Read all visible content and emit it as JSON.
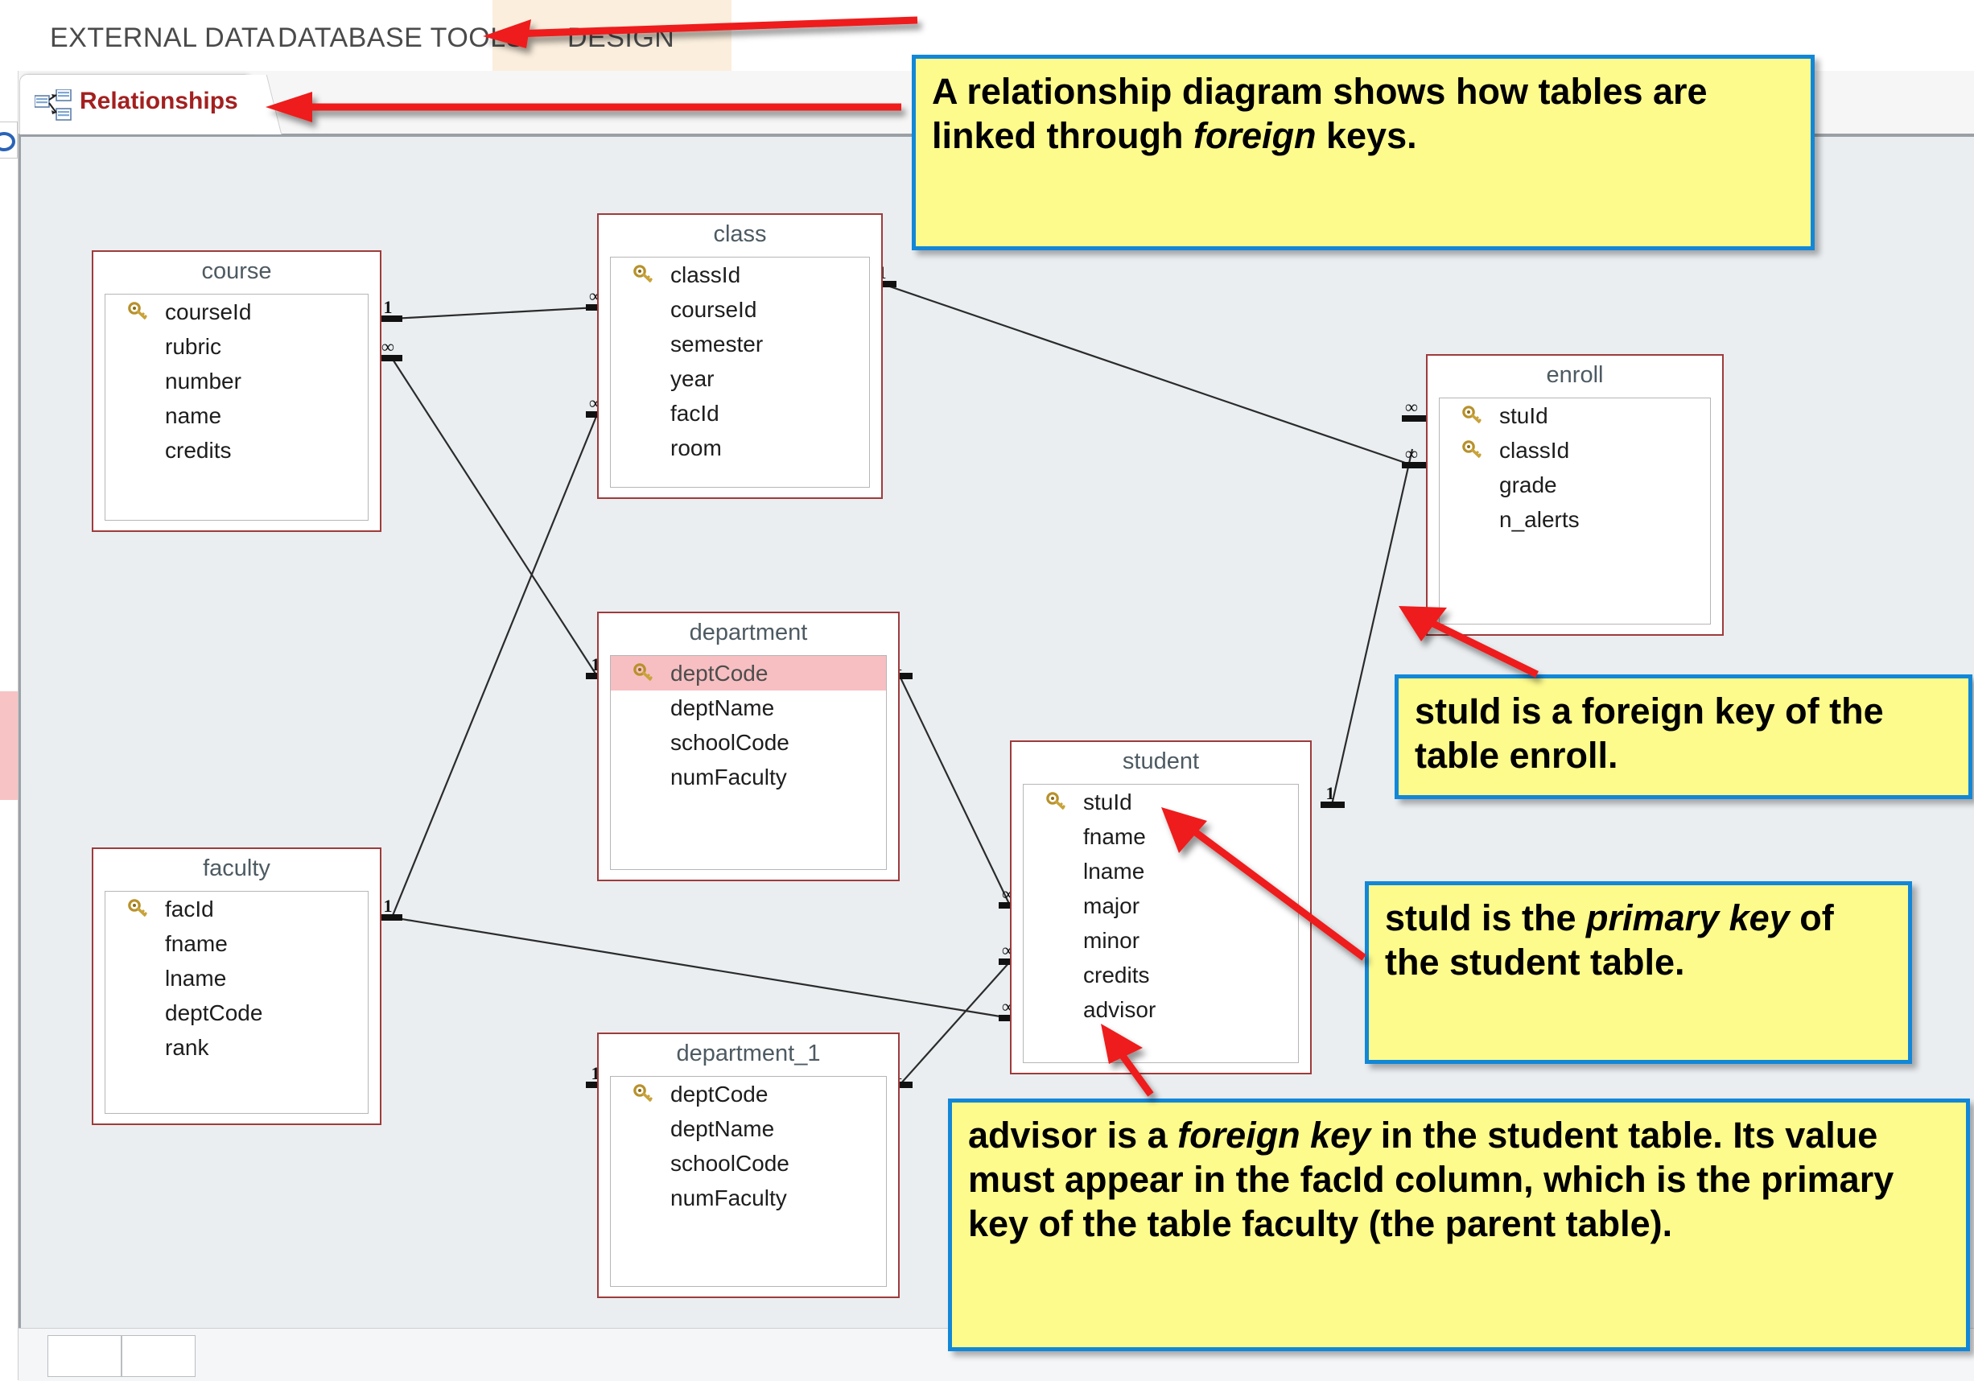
{
  "ribbon": {
    "tabs": [
      {
        "label": "EXTERNAL DATA"
      },
      {
        "label": "DATABASE TOOLS"
      },
      {
        "label": "DESIGN"
      }
    ]
  },
  "document_tab": {
    "label": "Relationships",
    "icon": "relationships-icon"
  },
  "diagram": {
    "type": "relationship-diagram",
    "tables": [
      {
        "name": "course",
        "fields": [
          {
            "label": "courseId",
            "primary_key": true,
            "selected": false
          },
          {
            "label": "rubric",
            "primary_key": false,
            "selected": false
          },
          {
            "label": "number",
            "primary_key": false,
            "selected": false
          },
          {
            "label": "name",
            "primary_key": false,
            "selected": false
          },
          {
            "label": "credits",
            "primary_key": false,
            "selected": false
          }
        ]
      },
      {
        "name": "class",
        "fields": [
          {
            "label": "classId",
            "primary_key": true,
            "selected": false
          },
          {
            "label": "courseId",
            "primary_key": false,
            "selected": false
          },
          {
            "label": "semester",
            "primary_key": false,
            "selected": false
          },
          {
            "label": "year",
            "primary_key": false,
            "selected": false
          },
          {
            "label": "facId",
            "primary_key": false,
            "selected": false
          },
          {
            "label": "room",
            "primary_key": false,
            "selected": false
          }
        ]
      },
      {
        "name": "enroll",
        "fields": [
          {
            "label": "stuId",
            "primary_key": true,
            "selected": false
          },
          {
            "label": "classId",
            "primary_key": true,
            "selected": false
          },
          {
            "label": "grade",
            "primary_key": false,
            "selected": false
          },
          {
            "label": "n_alerts",
            "primary_key": false,
            "selected": false
          }
        ]
      },
      {
        "name": "department",
        "fields": [
          {
            "label": "deptCode",
            "primary_key": true,
            "selected": true
          },
          {
            "label": "deptName",
            "primary_key": false,
            "selected": false
          },
          {
            "label": "schoolCode",
            "primary_key": false,
            "selected": false
          },
          {
            "label": "numFaculty",
            "primary_key": false,
            "selected": false
          }
        ]
      },
      {
        "name": "student",
        "fields": [
          {
            "label": "stuId",
            "primary_key": true,
            "selected": false
          },
          {
            "label": "fname",
            "primary_key": false,
            "selected": false
          },
          {
            "label": "lname",
            "primary_key": false,
            "selected": false
          },
          {
            "label": "major",
            "primary_key": false,
            "selected": false
          },
          {
            "label": "minor",
            "primary_key": false,
            "selected": false
          },
          {
            "label": "credits",
            "primary_key": false,
            "selected": false
          },
          {
            "label": "advisor",
            "primary_key": false,
            "selected": false
          }
        ]
      },
      {
        "name": "faculty",
        "fields": [
          {
            "label": "facId",
            "primary_key": true,
            "selected": false
          },
          {
            "label": "fname",
            "primary_key": false,
            "selected": false
          },
          {
            "label": "lname",
            "primary_key": false,
            "selected": false
          },
          {
            "label": "deptCode",
            "primary_key": false,
            "selected": false
          },
          {
            "label": "rank",
            "primary_key": false,
            "selected": false
          }
        ]
      },
      {
        "name": "department_1",
        "fields": [
          {
            "label": "deptCode",
            "primary_key": true,
            "selected": false
          },
          {
            "label": "deptName",
            "primary_key": false,
            "selected": false
          },
          {
            "label": "schoolCode",
            "primary_key": false,
            "selected": false
          },
          {
            "label": "numFaculty",
            "primary_key": false,
            "selected": false
          }
        ]
      }
    ],
    "relationships": [
      {
        "from": "course",
        "to": "class",
        "from_cardinality": "1",
        "to_cardinality": "∞"
      },
      {
        "from": "course",
        "to": "department",
        "from_cardinality": "∞",
        "to_cardinality": "1"
      },
      {
        "from": "class",
        "to": "enroll",
        "from_cardinality": "1",
        "to_cardinality": "∞"
      },
      {
        "from": "class",
        "to": "faculty",
        "from_cardinality": "∞",
        "to_cardinality": "1"
      },
      {
        "from": "department",
        "to": "student",
        "from_cardinality": "1",
        "to_cardinality": "∞"
      },
      {
        "from": "faculty",
        "to": "student",
        "from_cardinality": "1",
        "to_cardinality": "∞"
      },
      {
        "from": "department_1",
        "to": "student",
        "from_cardinality": "1",
        "to_cardinality": "∞"
      },
      {
        "from": "student",
        "to": "enroll",
        "from_cardinality": "1",
        "to_cardinality": "∞"
      }
    ]
  },
  "callouts": [
    {
      "id": "callout-relationship-diagram",
      "runs": [
        {
          "text": "A relationship diagram shows how tables are linked through ",
          "italic": false
        },
        {
          "text": "foreign",
          "italic": true
        },
        {
          "text": " keys.",
          "italic": false
        }
      ]
    },
    {
      "id": "callout-stuid-foreign-key",
      "runs": [
        {
          "text": "stuId is a foreign key of the table enroll.",
          "italic": false
        }
      ]
    },
    {
      "id": "callout-stuid-primary-key",
      "runs": [
        {
          "text": "stuId is the ",
          "italic": false
        },
        {
          "text": "primary key",
          "italic": true
        },
        {
          "text": " of the student table.",
          "italic": false
        }
      ]
    },
    {
      "id": "callout-advisor-foreign-key",
      "runs": [
        {
          "text": "advisor is a ",
          "italic": false
        },
        {
          "text": "foreign key",
          "italic": true
        },
        {
          "text": " in the student table. Its value must appear in the facId column, which is the primary key of the table faculty (the parent table).",
          "italic": false
        }
      ]
    }
  ],
  "colors": {
    "callout_fill": "#fdfb8c",
    "callout_border": "#1287d8",
    "table_border": "#9e3b3b",
    "canvas": "#eaeef1",
    "selected_field": "#f7bfc2",
    "tab_label": "#a32020",
    "arrow": "#ee1c1c"
  }
}
